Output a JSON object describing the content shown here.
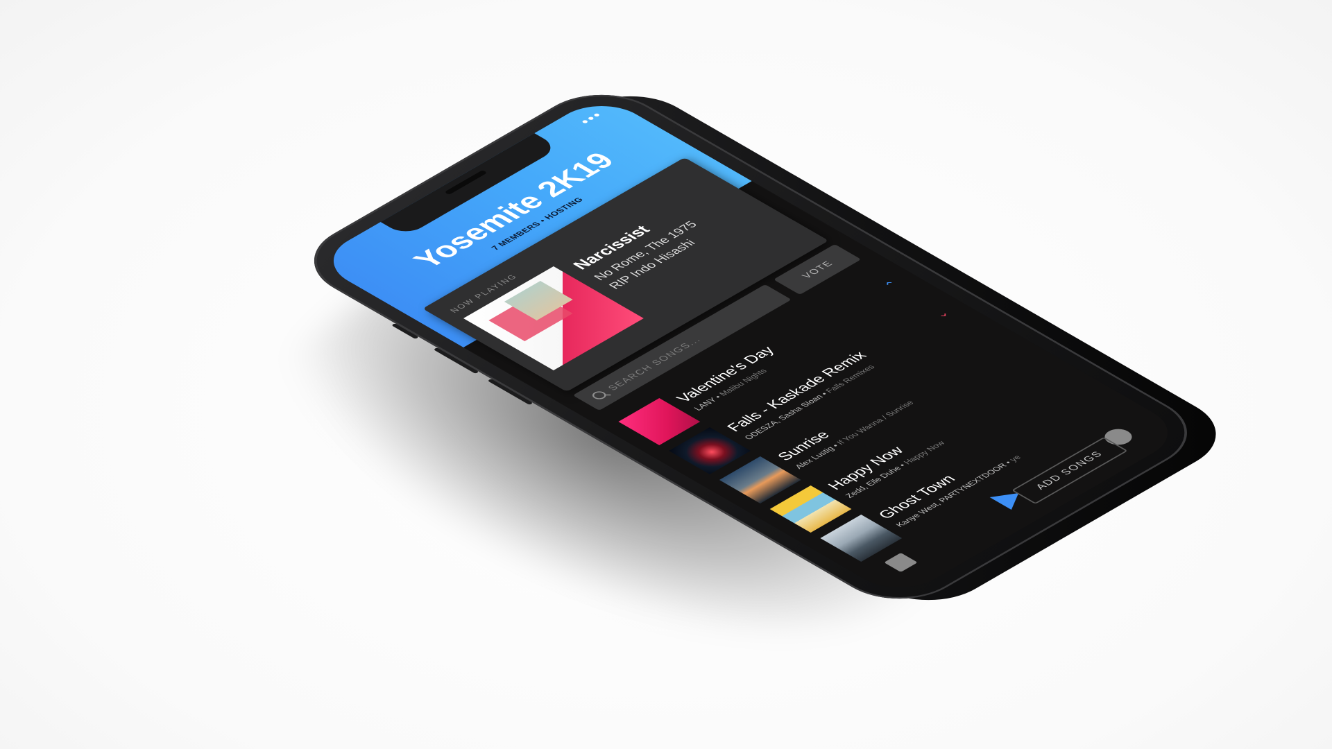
{
  "app": {
    "title": "Yosemite 2K19",
    "subtitle": "7 MEMBERS • HOSTING",
    "more_label": "•••"
  },
  "now_playing": {
    "label": "NOW PLAYING",
    "song": "Narcissist",
    "artists": "No Rome, The 1975",
    "album": "RIP Indo Hisashi"
  },
  "search": {
    "placeholder": "SEARCH SONGS..."
  },
  "vote": {
    "label": "VOTE"
  },
  "songs": [
    {
      "title": "Valentine's Day",
      "artist": "LANY",
      "album": "Malibu Nights",
      "vote": "up"
    },
    {
      "title": "Falls - Kaskade Remix",
      "artist": "ODESZA, Sasha Sloan",
      "album": "Falls Remixes",
      "vote": "down"
    },
    {
      "title": "Sunrise",
      "artist": "Alex Lustig",
      "album": "If You Wanna / Sunrise",
      "vote": ""
    },
    {
      "title": "Happy Now",
      "artist": "Zedd, Elle Duhe",
      "album": "Happy Now",
      "vote": ""
    },
    {
      "title": "Ghost Town",
      "artist": "Kanye West, PARTYNEXTDOOR",
      "album": "ye",
      "vote": ""
    }
  ],
  "add_songs": {
    "label": "ADD SONGS"
  },
  "icons": {
    "more": "more-icon",
    "search": "search-icon",
    "up": "chevron-up-icon",
    "down": "chevron-down-icon",
    "stop": "stop-icon",
    "play": "play-icon",
    "circle": "circle-icon"
  },
  "colors": {
    "accent_blue": "#3d8ff5",
    "header_light": "#52b8fb",
    "downvote_red": "#e8425f",
    "screen_bg": "#131212",
    "card_bg": "#2f2f30"
  }
}
